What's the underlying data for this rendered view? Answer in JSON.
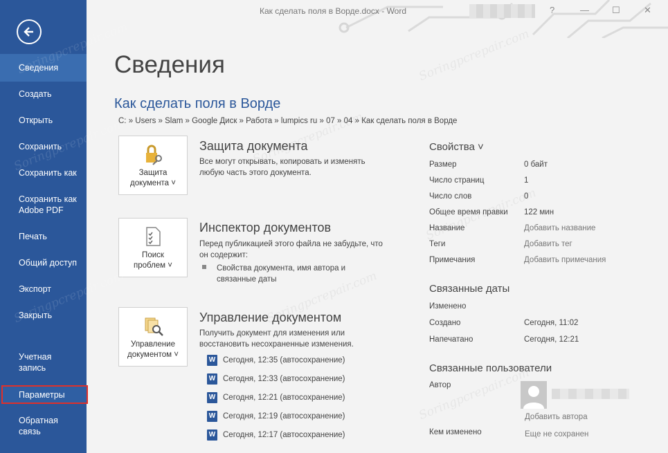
{
  "window": {
    "title": "Как сделать поля в Ворде.docx - Word",
    "help": "?",
    "minimize": "—",
    "maximize": "☐",
    "close": "✕"
  },
  "sidebar": {
    "back_icon": "back-arrow-icon",
    "items": [
      {
        "label": "Сведения",
        "active": true
      },
      {
        "label": "Создать"
      },
      {
        "label": "Открыть"
      },
      {
        "label": "Сохранить"
      },
      {
        "label": "Сохранить как"
      },
      {
        "label": "Сохранить как Adobe PDF"
      },
      {
        "label": "Печать"
      },
      {
        "label": "Общий доступ"
      },
      {
        "label": "Экспорт"
      },
      {
        "label": "Закрыть"
      },
      {
        "label": "Учетная запись"
      },
      {
        "label": "Параметры",
        "highlighted": true
      },
      {
        "label": "Обратная связь"
      }
    ]
  },
  "main": {
    "page_title": "Сведения",
    "doc_title": "Как сделать поля в Ворде",
    "breadcrumb": "C: » Users » Slam » Google Диск » Работа » lumpics ru » 07 » 04 » Как сделать поля в Ворде",
    "protect": {
      "tile_line1": "Защита",
      "tile_line2": "документа ˅",
      "title": "Защита документа",
      "desc": "Все могут открывать, копировать и изменять любую часть этого документа."
    },
    "inspect": {
      "tile_line1": "Поиск",
      "tile_line2": "проблем ˅",
      "title": "Инспектор документов",
      "desc": "Перед публикацией этого файла не забудьте, что он содержит:",
      "bullet": "Свойства документа, имя автора и связанные даты"
    },
    "manage": {
      "tile_line1": "Управление",
      "tile_line2": "документом ˅",
      "title": "Управление документом",
      "desc": "Получить документ для изменения или восстановить несохраненные изменения.",
      "versions": [
        "Сегодня, 12:35 (автосохранение)",
        "Сегодня, 12:33 (автосохранение)",
        "Сегодня, 12:21 (автосохранение)",
        "Сегодня, 12:19 (автосохранение)",
        "Сегодня, 12:17 (автосохранение)"
      ]
    }
  },
  "properties": {
    "header": "Свойства ˅",
    "rows": [
      {
        "label": "Размер",
        "value": "0 байт"
      },
      {
        "label": "Число страниц",
        "value": "1"
      },
      {
        "label": "Число слов",
        "value": "0"
      },
      {
        "label": "Общее время правки",
        "value": "122 мин"
      },
      {
        "label": "Название",
        "value": "Добавить название"
      },
      {
        "label": "Теги",
        "value": "Добавить тег"
      },
      {
        "label": "Примечания",
        "value": "Добавить примечания"
      }
    ],
    "dates_header": "Связанные даты",
    "dates": [
      {
        "label": "Изменено",
        "value": ""
      },
      {
        "label": "Создано",
        "value": "Сегодня, 11:02"
      },
      {
        "label": "Напечатано",
        "value": "Сегодня, 12:21"
      }
    ],
    "people_header": "Связанные пользователи",
    "author_label": "Автор",
    "add_author": "Добавить автора",
    "modified_by_label": "Кем изменено",
    "modified_by_value": "Еще не сохранен"
  },
  "watermark": "Soringpcrepair.com",
  "colors": {
    "sidebar": "#2b579a",
    "accent_title": "#2b579a",
    "highlight_box": "#e0302a"
  }
}
